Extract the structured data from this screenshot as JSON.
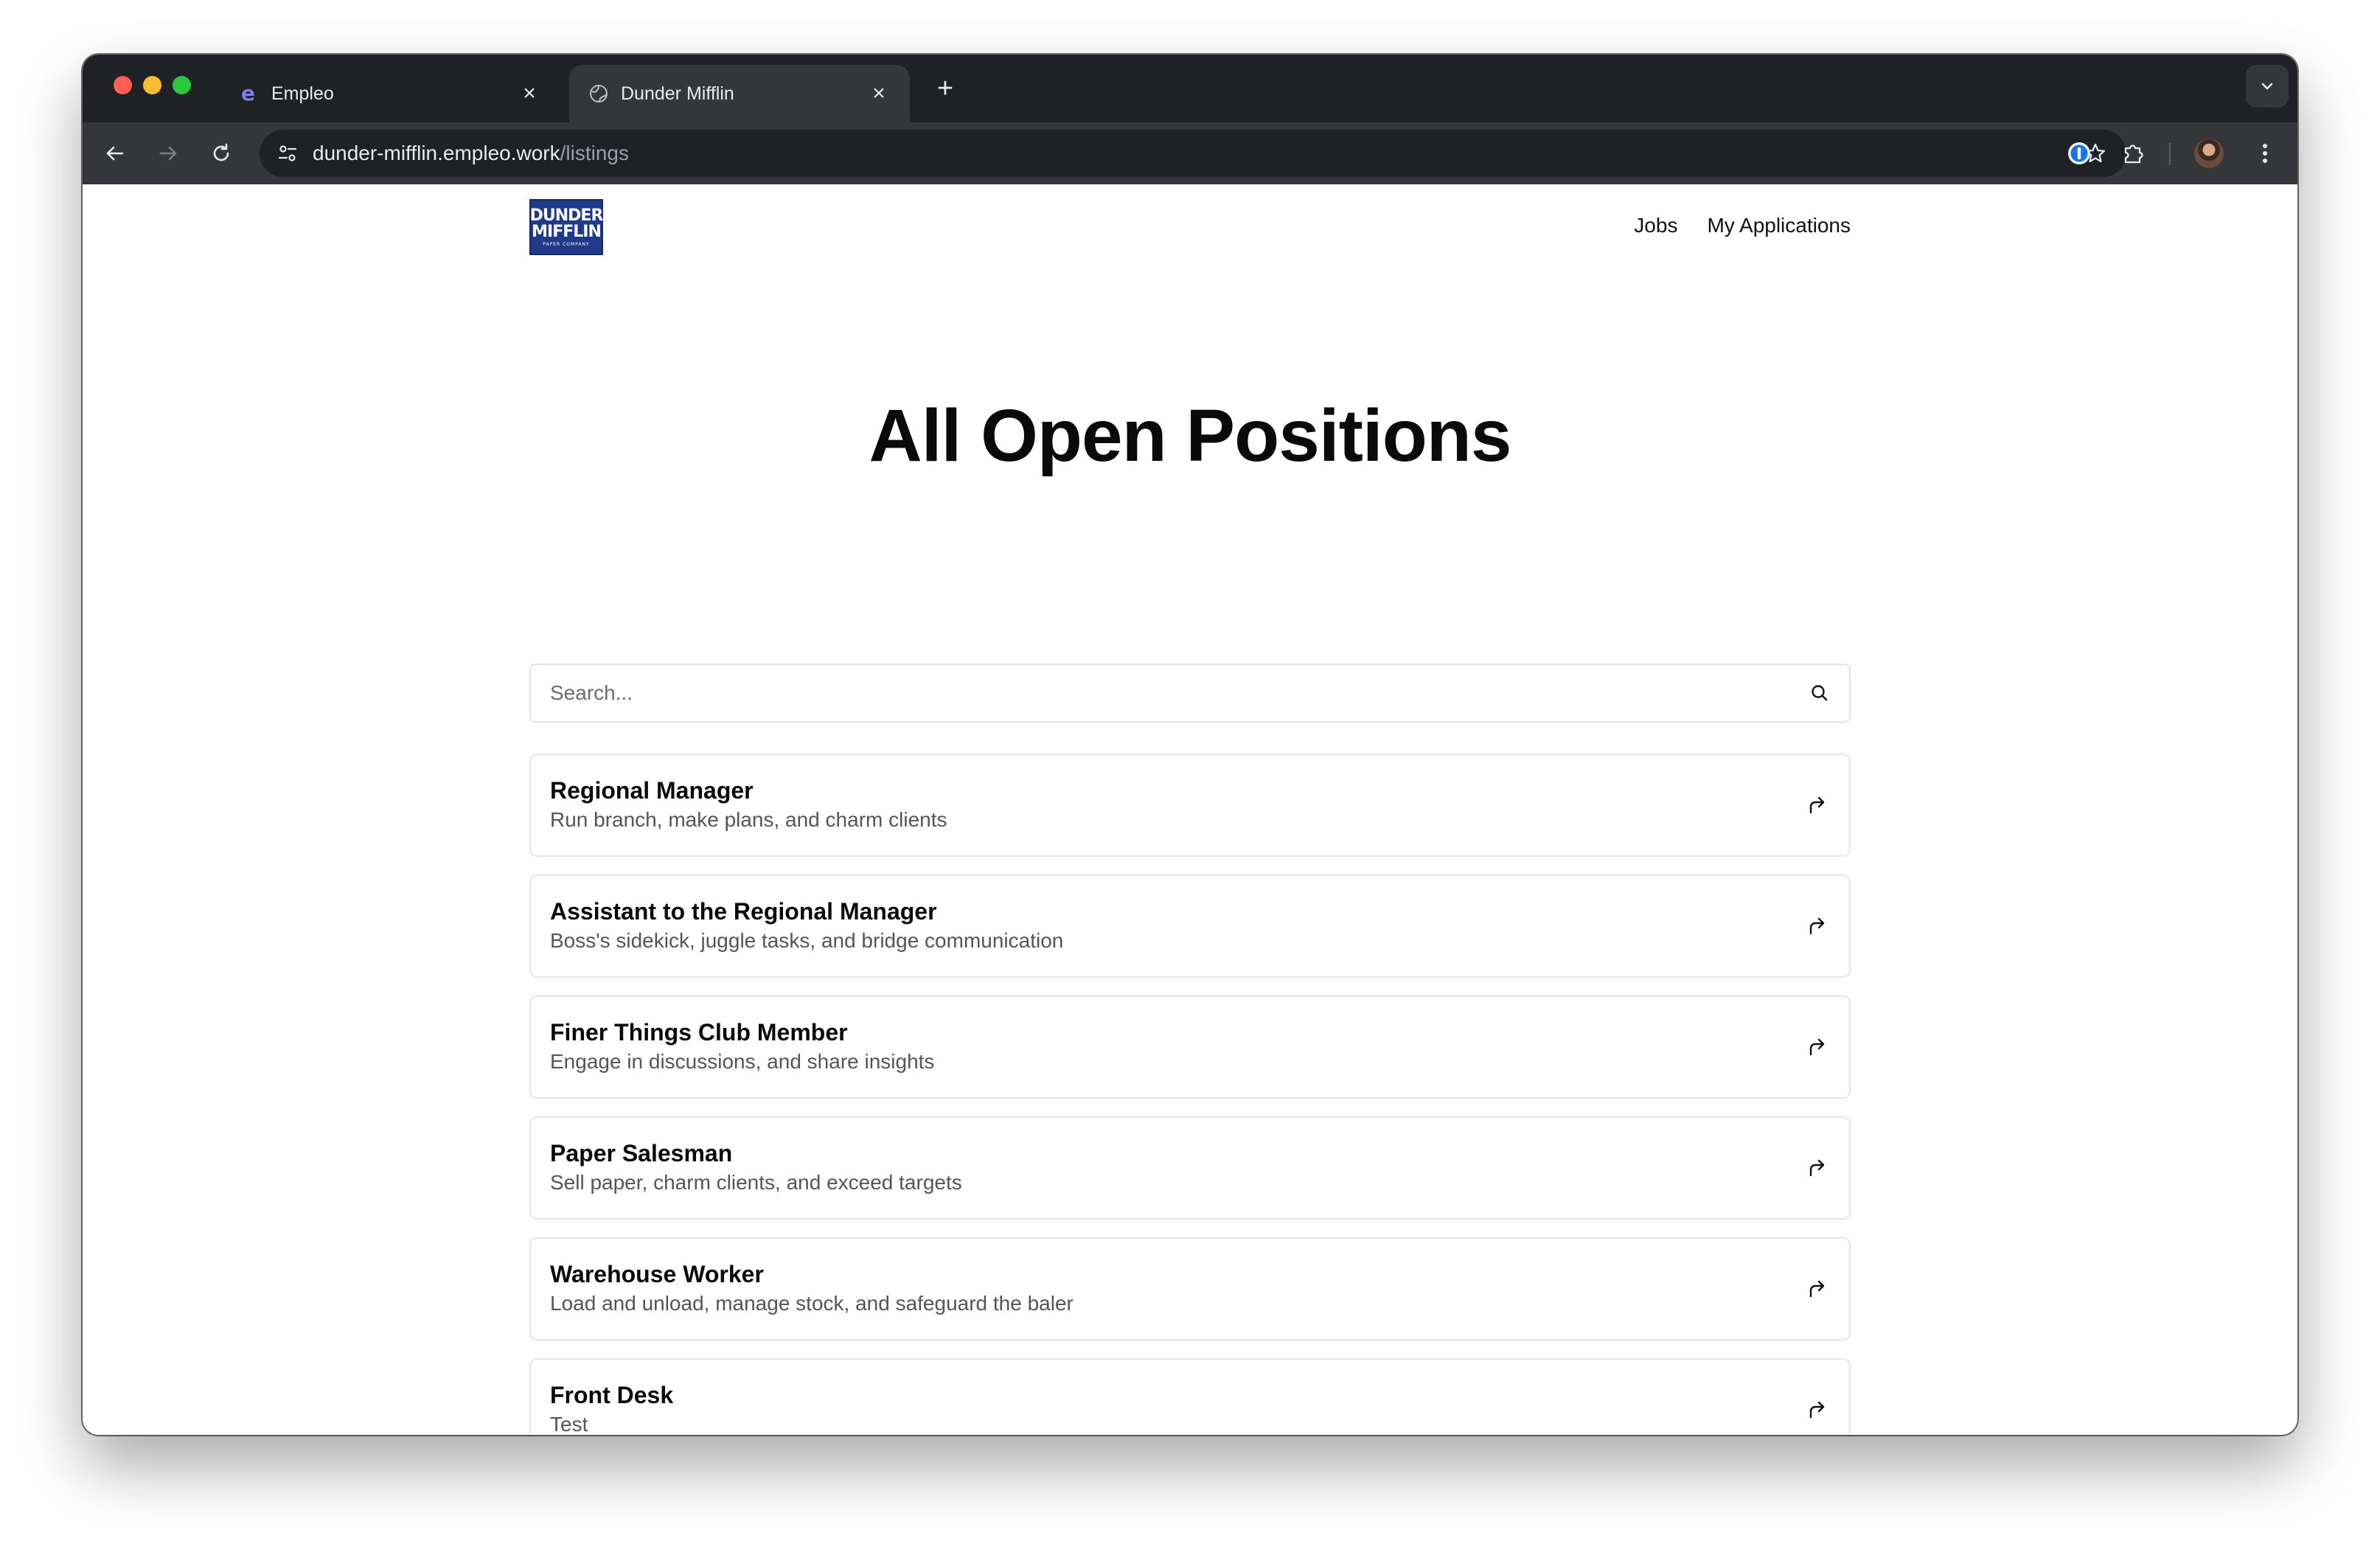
{
  "browser": {
    "tabs": [
      {
        "title": "Empleo",
        "favicon": "empleo-e-icon",
        "active": false
      },
      {
        "title": "Dunder Mifflin",
        "favicon": "globe-icon",
        "active": true
      }
    ],
    "new_tab_icon": "plus-icon",
    "url_host": "dunder-mifflin.empleo.work",
    "url_path": "/listings"
  },
  "site": {
    "logo": {
      "line1": "DUNDER",
      "line2": "MIFFLIN",
      "line3": "PAPER COMPANY"
    },
    "nav": [
      {
        "label": "Jobs"
      },
      {
        "label": "My Applications"
      }
    ]
  },
  "main": {
    "heading": "All Open Positions",
    "search_placeholder": "Search..."
  },
  "listings": [
    {
      "title": "Regional Manager",
      "description": "Run branch, make plans, and charm clients"
    },
    {
      "title": "Assistant to the Regional Manager",
      "description": "Boss's sidekick, juggle tasks, and bridge communication"
    },
    {
      "title": "Finer Things Club Member",
      "description": "Engage in discussions, and share insights"
    },
    {
      "title": "Paper Salesman",
      "description": "Sell paper, charm clients, and exceed targets"
    },
    {
      "title": "Warehouse Worker",
      "description": "Load and unload, manage stock, and safeguard the baler"
    },
    {
      "title": "Front Desk",
      "description": "Test"
    },
    {
      "title": "",
      "description": ""
    }
  ],
  "colors": {
    "tabstrip": "#202124",
    "toolbar": "#35363a",
    "logo_bg": "#1f3a8a",
    "text_primary": "#0a0a0a",
    "text_secondary": "#555555"
  }
}
